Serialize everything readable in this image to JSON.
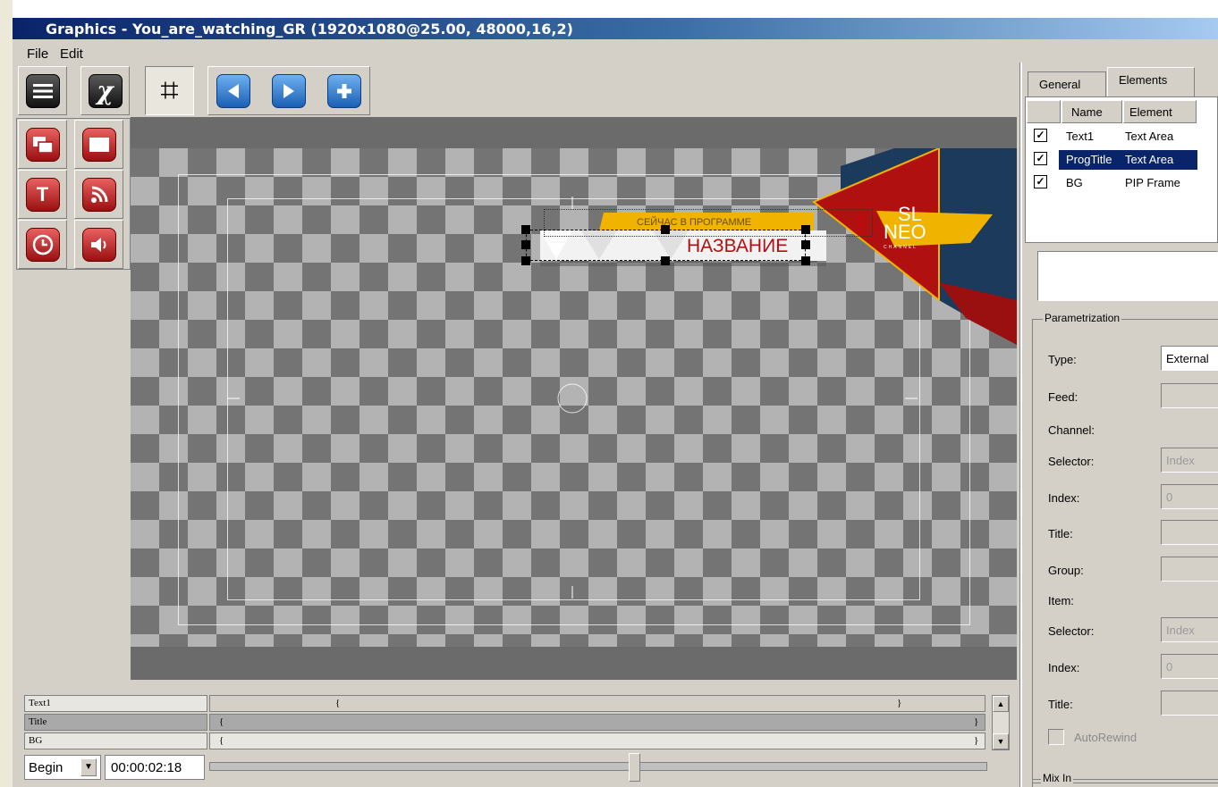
{
  "window": {
    "title": "Graphics - You_are_watching_GR (1920x1080@25.00, 48000,16,2)"
  },
  "menu": [
    "File",
    "Edit"
  ],
  "canvas": {
    "overlay": {
      "subtitle": "СЕЙЧАС В ПРОГРАММЕ",
      "title": "НАЗВАНИЕ",
      "logo_line1": "SL",
      "logo_line2": "NEO",
      "logo_line3": "CHANNEL"
    }
  },
  "timeline": {
    "tracks": [
      {
        "name": "Text1",
        "open": "{",
        "close": "}"
      },
      {
        "name": "Title",
        "open": "{",
        "close": "}"
      },
      {
        "name": "BG",
        "open": "{",
        "close": "}"
      }
    ],
    "mode": "Begin",
    "timecode": "00:00:02:18"
  },
  "panel": {
    "tabs": [
      "General",
      "Elements"
    ],
    "columns": [
      "Name",
      "Element"
    ],
    "elements": [
      {
        "name": "Text1",
        "element": "Text Area",
        "checked": true,
        "selected": false
      },
      {
        "name": "ProgTitle",
        "element": "Text Area",
        "checked": true,
        "selected": true
      },
      {
        "name": "BG",
        "element": "PIP Frame",
        "checked": true,
        "selected": false
      }
    ],
    "param_group": "Parametrization",
    "params": {
      "type_label": "Type:",
      "type_value": "External",
      "feed_label": "Feed:",
      "channel_label": "Channel:",
      "selector1_label": "Selector:",
      "selector1_value": "Index",
      "index1_label": "Index:",
      "index1_value": "0",
      "title1_label": "Title:",
      "group_label": "Group:",
      "item_label": "Item:",
      "selector2_label": "Selector:",
      "selector2_value": "Index",
      "index2_label": "Index:",
      "index2_value": "0",
      "title2_label": "Title:",
      "autorewind_label": "AutoRewind"
    },
    "mix_in_label": "Mix In"
  },
  "colors": {
    "accent_red": "#b01010",
    "overlay_gold": "#f0b400",
    "overlay_navy": "#1c3a5c",
    "selection": "#0a246a"
  }
}
